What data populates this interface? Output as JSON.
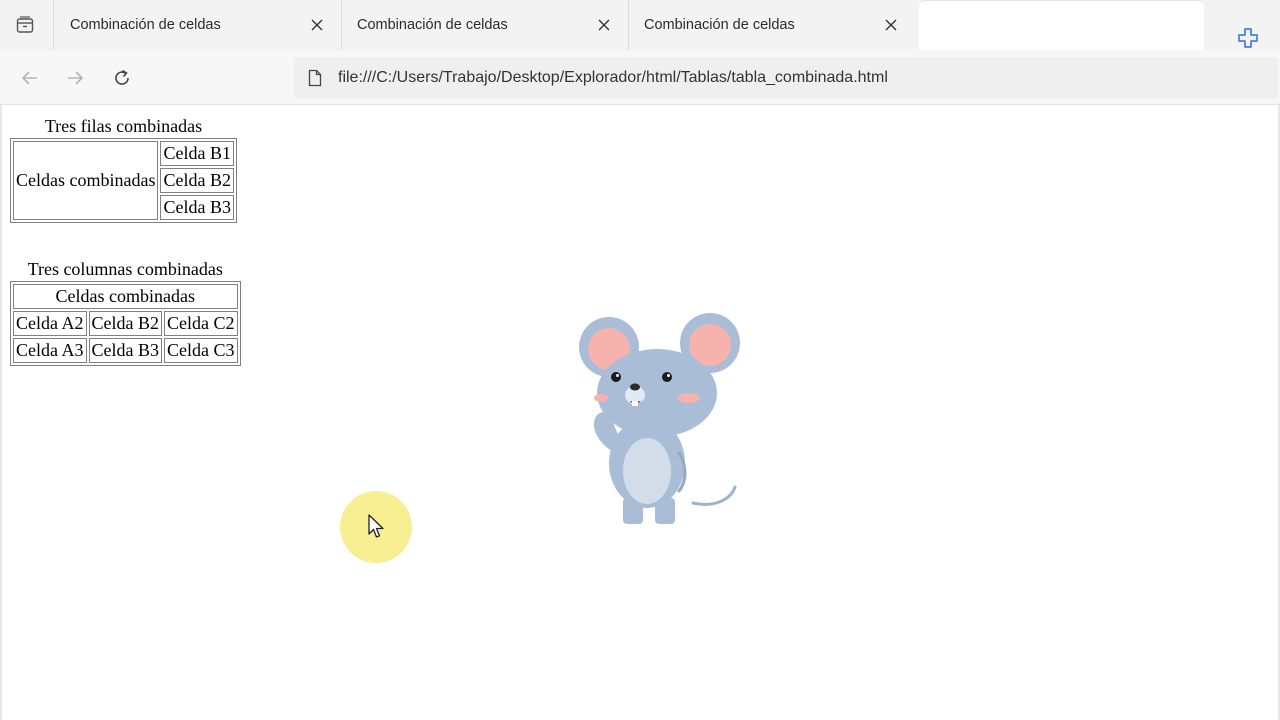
{
  "browser": {
    "tabs": [
      {
        "title": "Combinación de celdas"
      },
      {
        "title": "Combinación de celdas"
      },
      {
        "title": "Combinación de celdas"
      }
    ],
    "address": "file:///C:/Users/Trabajo/Desktop/Explorador/html/Tablas/tabla_combinada.html"
  },
  "icons": {
    "tab_actions": "tab-actions-icon",
    "close": "close-icon",
    "new_tab": "new-tab-icon",
    "back": "back-arrow-icon",
    "forward": "forward-arrow-icon",
    "reload": "reload-icon",
    "file": "file-icon"
  },
  "page": {
    "table_rows": {
      "caption": "Tres filas combinadas",
      "merged": "Celdas combinadas",
      "cells": [
        "Celda B1",
        "Celda B2",
        "Celda B3"
      ]
    },
    "table_cols": {
      "caption": "Tres columnas combinadas",
      "merged": "Celdas combinadas",
      "rows": [
        [
          "Celda A2",
          "Celda B2",
          "Celda C2"
        ],
        [
          "Celda A3",
          "Celda B3",
          "Celda C3"
        ]
      ]
    }
  },
  "colors": {
    "cursor_highlight": "#f7ee8c",
    "mouse_body": "#a9bdd6",
    "mouse_ear_inner": "#f6b3ad"
  }
}
